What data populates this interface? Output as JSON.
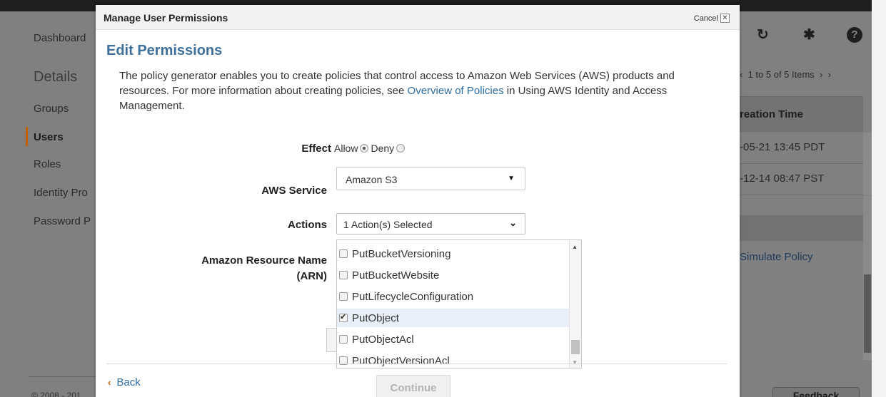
{
  "background": {
    "sidebar": {
      "dashboard": "Dashboard",
      "details": "Details",
      "items": [
        "Groups",
        "Users",
        "Roles",
        "Identity Pro",
        "Password P"
      ]
    },
    "pager": "1 to 5 of 5 Items",
    "table": {
      "header": "reation Time",
      "rows": [
        "-05-21 13:45 PDT",
        "-12-14 08:47 PST"
      ]
    },
    "simulate_link": "Simulate Policy",
    "footer": "© 2008 - 201",
    "feedback": "Feedback"
  },
  "modal": {
    "title": "Manage User Permissions",
    "cancel_label": "Cancel",
    "cancel_icon": "✕",
    "heading": "Edit Permissions",
    "intro_before": "The policy generator enables you to create policies that control access to Amazon Web Services (AWS) products and resources. For more information about creating policies, see ",
    "intro_link": "Overview of Policies",
    "intro_after": " in Using AWS Identity and Access Management.",
    "effect": {
      "label": "Effect",
      "allow": "Allow",
      "deny": "Deny"
    },
    "service": {
      "label": "AWS Service",
      "value": "Amazon S3"
    },
    "actions": {
      "label": "Actions",
      "value": "1 Action(s) Selected",
      "items": [
        {
          "label": "PutBucketVersioning",
          "checked": false
        },
        {
          "label": "PutBucketWebsite",
          "checked": false
        },
        {
          "label": "PutLifecycleConfiguration",
          "checked": false
        },
        {
          "label": "PutObject",
          "checked": true
        },
        {
          "label": "PutObjectAcl",
          "checked": false
        },
        {
          "label": "PutObjectVersionAcl",
          "checked": false
        }
      ]
    },
    "arn_label_1": "Amazon Resource Name",
    "arn_label_2": "(ARN)",
    "back_label": "Back",
    "continue_label": "Continue"
  }
}
